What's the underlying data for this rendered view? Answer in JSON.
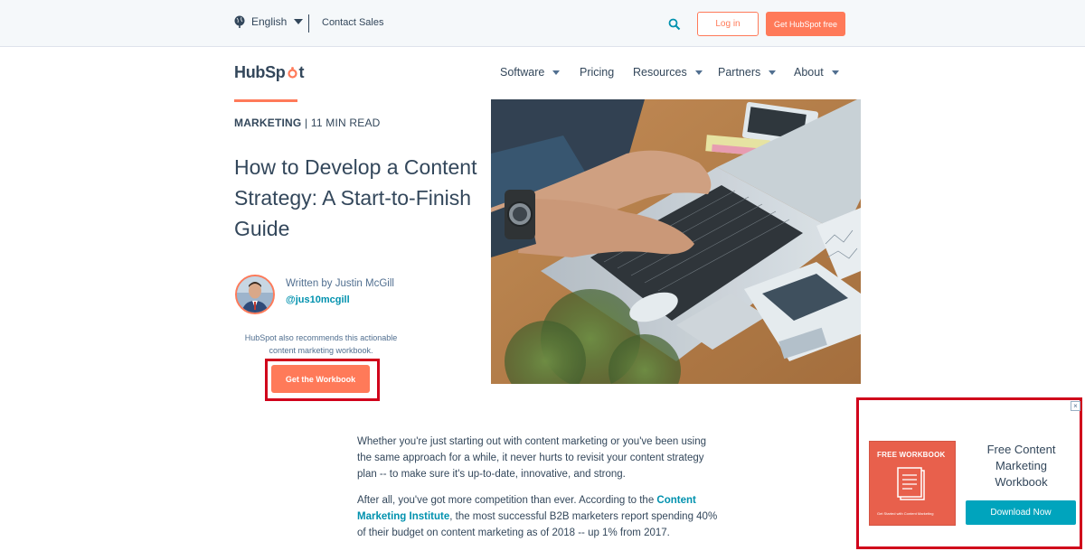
{
  "utility": {
    "language": "English",
    "contact": "Contact Sales",
    "login": "Log in",
    "cta": "Get HubSpot free"
  },
  "nav": {
    "logo_pre": "HubSp",
    "logo_post": "t",
    "items": [
      "Software",
      "Pricing",
      "Resources",
      "Partners",
      "About"
    ]
  },
  "article": {
    "category": "MARKETING",
    "separator": " | ",
    "read_time": "11 MIN READ",
    "title": "How to Develop a Content Strategy: A Start-to-Finish Guide",
    "author_line": "Written by Justin McGill",
    "author_handle": "@jus10mcgill",
    "recommend_text": "HubSpot also recommends this actionable content marketing workbook.",
    "workbook_button": "Get the Workbook",
    "para1": "Whether you're just starting out with content marketing or you've been using the same approach for a while, it never hurts to revisit your content strategy plan -- to make sure it's up-to-date, innovative, and strong.",
    "para2_before": "After all, you've got more competition than ever. According to the ",
    "para2_link": "Content Marketing Institute",
    "para2_after": ", the most successful B2B marketers report spending 40% of their budget on content marketing as of 2018 -- up 1% from 2017."
  },
  "cta": {
    "close": "×",
    "cover_label": "FREE WORKBOOK",
    "cover_sub": "Get Started with Content Marketing",
    "heading": "Free Content Marketing Workbook",
    "button": "Download Now"
  },
  "colors": {
    "brand_orange": "#ff7a59",
    "text": "#33475b",
    "link": "#0091ae",
    "cta_teal": "#00a4bd",
    "highlight_red": "#d0021b"
  },
  "icons": [
    "globe-icon",
    "chevron-down-icon",
    "search-icon",
    "hubspot-sprocket-icon",
    "document-icon",
    "close-icon"
  ]
}
